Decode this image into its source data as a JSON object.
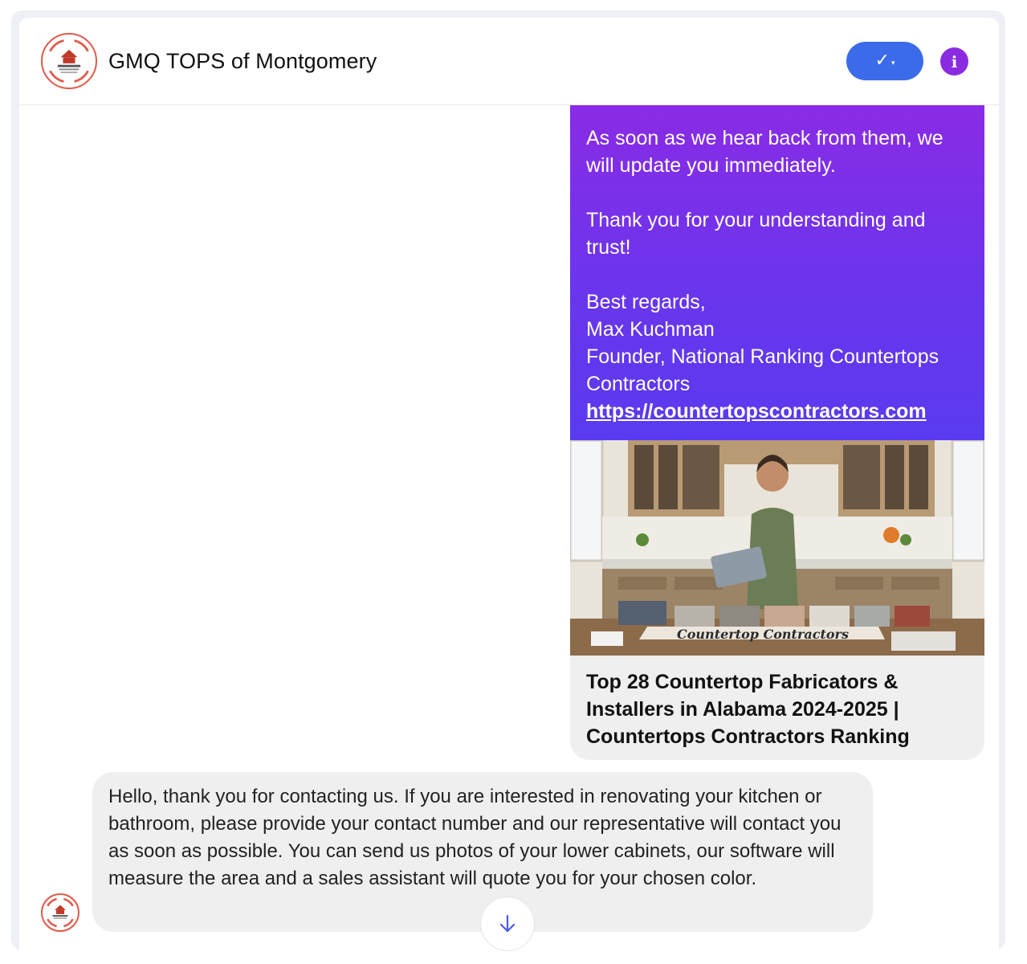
{
  "header": {
    "title": "GMQ TOPS of Montgomery",
    "status_check": "✓",
    "status_caret": "▾",
    "info_glyph": "i"
  },
  "colors": {
    "accent_blue": "#3b6be8",
    "accent_purple": "#8a2be2",
    "bubble_gradient_top": "#8a2be6",
    "bubble_gradient_bottom": "#5a3af0"
  },
  "outgoing_message": {
    "line1": "As soon as we hear back from them, we will update you immediately.",
    "line2": "Thank you for your understanding and trust!",
    "signoff": "Best regards,",
    "name": "Max Kuchman",
    "role": "Founder, National Ranking Countertops Contractors",
    "link": "https://countertopscontractors.com"
  },
  "link_preview": {
    "image_caption": "Countertop Contractors",
    "title": "Top 28 Countertop Fabricators & Installers in Alabama 2024-2025 | Countertops Contractors Ranking"
  },
  "incoming_message": {
    "text": "Hello, thank you for contacting us. If you are interested in renovating your kitchen or bathroom, please provide your contact number and our representative will contact you as soon as possible. You can send us photos of your lower cabinets, our software will measure the area and a sales assistant will quote you for your chosen color."
  },
  "icons": {
    "avatar": "gmq-tops-logo",
    "status": "check-dropdown-icon",
    "info": "info-icon",
    "scroll": "arrow-down-icon"
  }
}
